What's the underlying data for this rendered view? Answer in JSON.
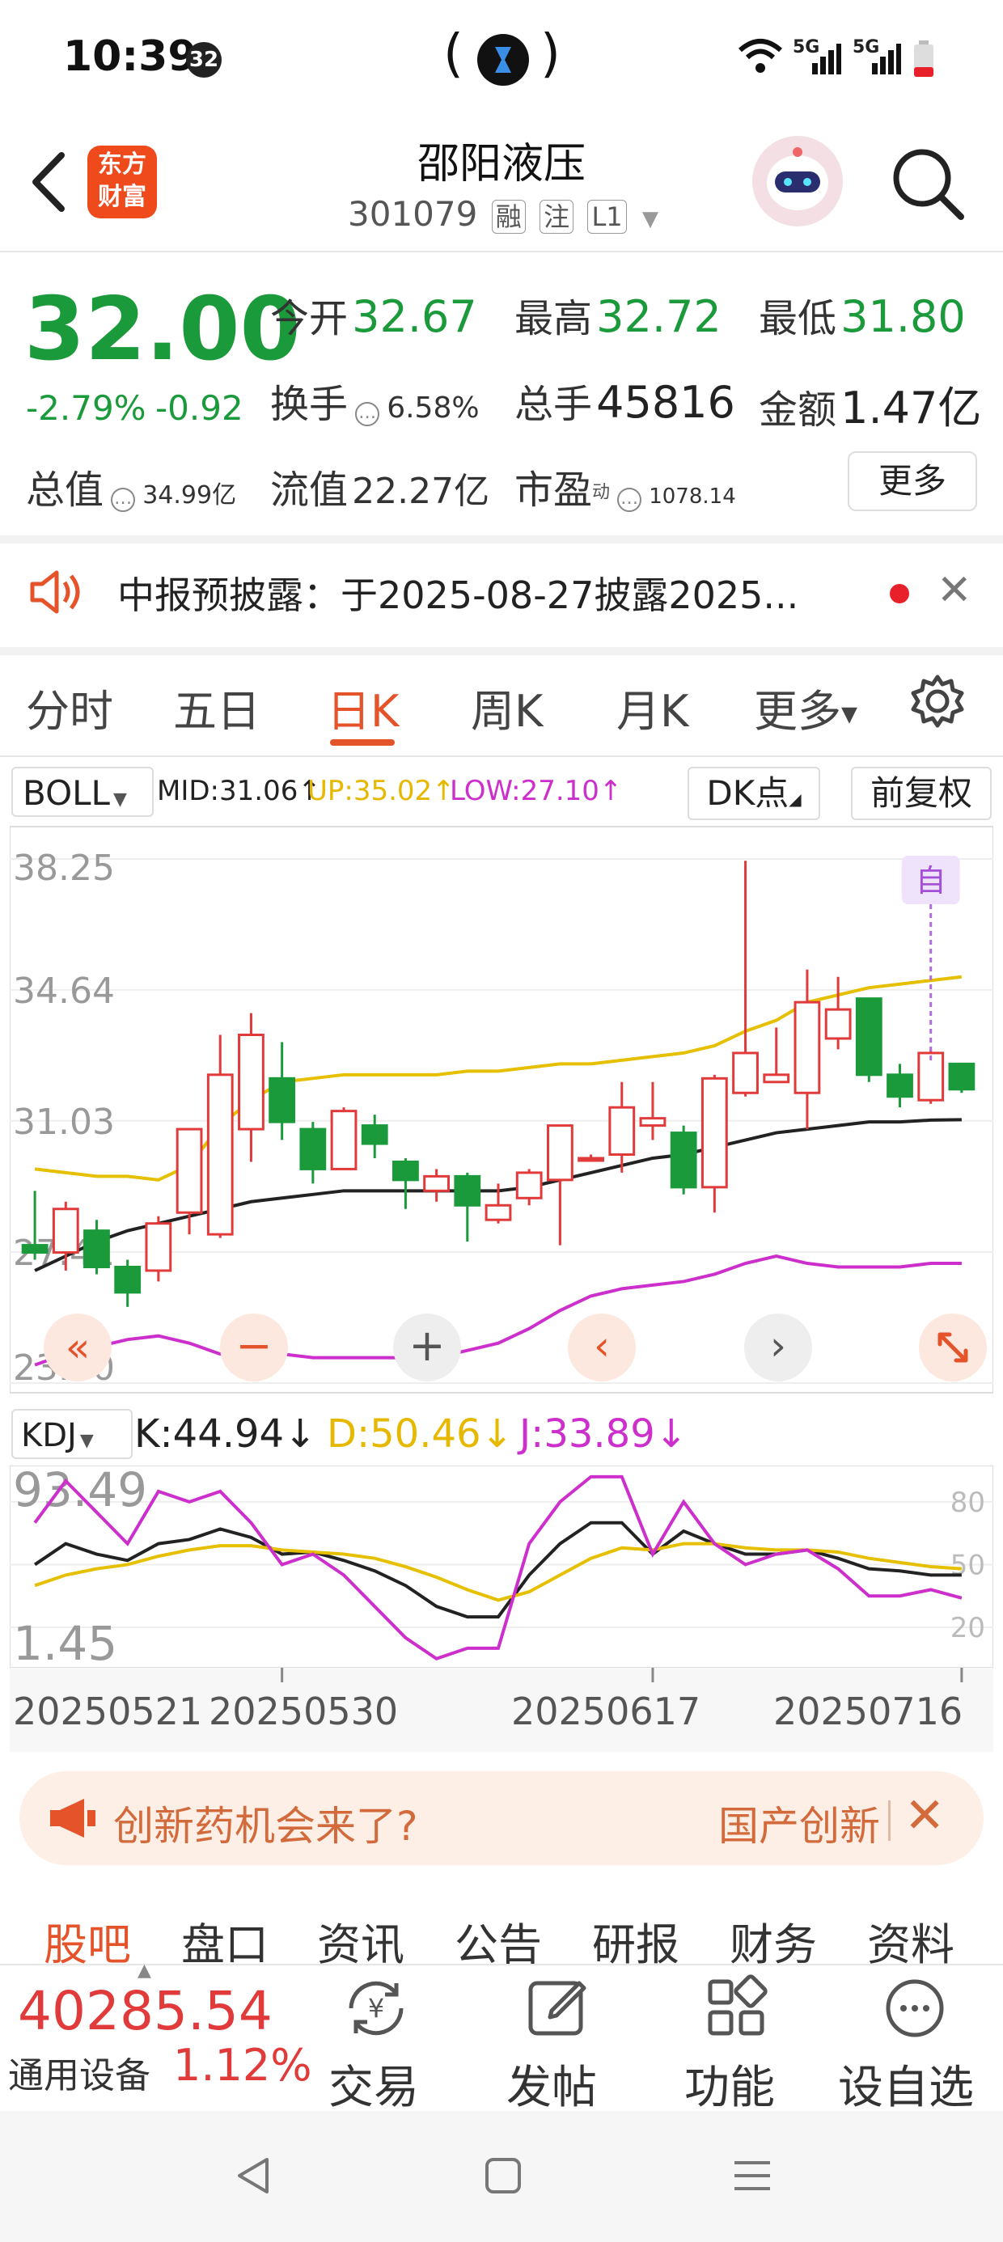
{
  "status_bar": {
    "time": "10:39",
    "badge": "32",
    "center_left": "(",
    "center_right": ")",
    "signal1": "5G",
    "signal2": "5G"
  },
  "header": {
    "logo_line1": "东方",
    "logo_line2": "财富",
    "title": "邵阳液压",
    "code": "301079",
    "tags": [
      "融",
      "注",
      "L1"
    ]
  },
  "quote": {
    "price": "32.00",
    "change_pct": "-2.79%",
    "change_amt": "-0.92",
    "open_label": "今开",
    "open": "32.67",
    "high_label": "最高",
    "high": "32.72",
    "low_label": "最低",
    "low": "31.80",
    "turnover_label": "换手",
    "turnover": "6.58%",
    "volume_label": "总手",
    "volume": "45816",
    "amount_label": "金额",
    "amount": "1.47亿",
    "mktcap_label": "总值",
    "mktcap": "34.99亿",
    "float_label": "流值",
    "float": "22.27亿",
    "pe_label": "市盈",
    "pe_sup": "动",
    "pe": "1078.14",
    "more": "更多"
  },
  "notice": {
    "text": "中报预披露：于2025-08-27披露2025..."
  },
  "tabs": [
    "分时",
    "五日",
    "日K",
    "周K",
    "月K",
    "更多"
  ],
  "chart_header": {
    "indicator": "BOLL",
    "mid": "MID:31.06↑",
    "up": "UP:35.02↑",
    "low": "LOW:27.10↑",
    "dk": "DK点",
    "adjust": "前复权",
    "kdj": "KDJ",
    "k": "K:44.94↓",
    "d": "D:50.46↓",
    "j": "J:33.89↓"
  },
  "colors": {
    "up": "#e13a3a",
    "down": "#1a9a3a",
    "mid_line": "#222222",
    "upper_band": "#e6c000",
    "lower_band": "#cc2fcc",
    "accent": "#e5532a"
  },
  "chart_data": [
    {
      "type": "candlestick",
      "y_ticks": [
        "38.25",
        "34.64",
        "31.03",
        "27.41",
        "23.80"
      ],
      "ylim": [
        23.8,
        38.25
      ],
      "x_ticks": [
        "20250521",
        "20250530",
        "20250617",
        "20250716"
      ],
      "marker": "自",
      "candles": [
        {
          "o": 27.6,
          "c": 27.4,
          "h": 29.1,
          "l": 27.2
        },
        {
          "o": 27.4,
          "c": 28.6,
          "h": 28.8,
          "l": 26.9
        },
        {
          "o": 28.0,
          "c": 27.0,
          "h": 28.3,
          "l": 26.8
        },
        {
          "o": 27.0,
          "c": 26.3,
          "h": 27.2,
          "l": 25.9
        },
        {
          "o": 26.9,
          "c": 28.2,
          "h": 28.4,
          "l": 26.6
        },
        {
          "o": 28.5,
          "c": 30.8,
          "h": 30.8,
          "l": 27.9
        },
        {
          "o": 27.9,
          "c": 32.3,
          "h": 33.4,
          "l": 27.8
        },
        {
          "o": 30.8,
          "c": 33.4,
          "h": 34.0,
          "l": 29.9
        },
        {
          "o": 32.2,
          "c": 31.0,
          "h": 33.2,
          "l": 30.5
        },
        {
          "o": 30.8,
          "c": 29.7,
          "h": 31.0,
          "l": 29.3
        },
        {
          "o": 29.7,
          "c": 31.3,
          "h": 31.4,
          "l": 29.7
        },
        {
          "o": 30.9,
          "c": 30.4,
          "h": 31.2,
          "l": 30.0
        },
        {
          "o": 29.9,
          "c": 29.4,
          "h": 30.0,
          "l": 28.6
        },
        {
          "o": 29.1,
          "c": 29.5,
          "h": 29.7,
          "l": 28.8
        },
        {
          "o": 29.5,
          "c": 28.7,
          "h": 29.6,
          "l": 27.7
        },
        {
          "o": 28.3,
          "c": 28.7,
          "h": 29.3,
          "l": 28.2
        },
        {
          "o": 28.9,
          "c": 29.6,
          "h": 29.7,
          "l": 28.7
        },
        {
          "o": 29.4,
          "c": 30.9,
          "h": 30.9,
          "l": 27.6
        },
        {
          "o": 30.0,
          "c": 30.0,
          "h": 30.1,
          "l": 29.9
        },
        {
          "o": 30.1,
          "c": 31.4,
          "h": 32.1,
          "l": 29.6
        },
        {
          "o": 30.9,
          "c": 31.1,
          "h": 32.1,
          "l": 30.5
        },
        {
          "o": 30.7,
          "c": 29.2,
          "h": 30.9,
          "l": 29.0
        },
        {
          "o": 29.2,
          "c": 32.2,
          "h": 32.3,
          "l": 28.5
        },
        {
          "o": 31.8,
          "c": 32.9,
          "h": 38.2,
          "l": 31.7
        },
        {
          "o": 32.1,
          "c": 32.3,
          "h": 33.6,
          "l": 32.1
        },
        {
          "o": 31.8,
          "c": 34.3,
          "h": 35.2,
          "l": 30.8
        },
        {
          "o": 33.3,
          "c": 34.1,
          "h": 35.0,
          "l": 33.0
        },
        {
          "o": 34.4,
          "c": 32.3,
          "h": 34.4,
          "l": 32.1
        },
        {
          "o": 32.3,
          "c": 31.7,
          "h": 32.6,
          "l": 31.4
        },
        {
          "o": 31.6,
          "c": 32.9,
          "h": 33.0,
          "l": 31.5
        },
        {
          "o": 32.6,
          "c": 31.9,
          "h": 32.6,
          "l": 31.8
        }
      ],
      "series": [
        {
          "name": "MID",
          "values": [
            26.9,
            27.3,
            27.7,
            28.0,
            28.2,
            28.4,
            28.6,
            28.8,
            28.9,
            29.0,
            29.1,
            29.1,
            29.1,
            29.1,
            29.1,
            29.1,
            29.2,
            29.4,
            29.6,
            29.8,
            30.0,
            30.1,
            30.3,
            30.5,
            30.7,
            30.8,
            30.9,
            31.0,
            31.0,
            31.05,
            31.06
          ]
        },
        {
          "name": "UP",
          "values": [
            29.7,
            29.6,
            29.5,
            29.5,
            29.4,
            29.8,
            30.9,
            31.6,
            32.1,
            32.2,
            32.3,
            32.3,
            32.3,
            32.3,
            32.4,
            32.4,
            32.5,
            32.6,
            32.6,
            32.7,
            32.8,
            32.9,
            33.1,
            33.5,
            33.8,
            34.3,
            34.5,
            34.7,
            34.8,
            34.9,
            35.0
          ]
        },
        {
          "name": "LOW",
          "values": [
            24.3,
            24.6,
            24.8,
            25.0,
            25.1,
            24.9,
            24.6,
            24.6,
            24.6,
            24.5,
            24.5,
            24.5,
            24.5,
            24.5,
            24.7,
            24.9,
            25.3,
            25.8,
            26.2,
            26.4,
            26.5,
            26.6,
            26.8,
            27.1,
            27.3,
            27.1,
            27.0,
            27.0,
            27.0,
            27.1,
            27.1
          ]
        }
      ]
    },
    {
      "type": "line",
      "name": "KDJ",
      "y_ticks": [
        "93.49",
        "1.45"
      ],
      "grid_labels": [
        "80",
        "50",
        "20"
      ],
      "ylim": [
        1.45,
        93.49
      ],
      "series": [
        {
          "name": "K",
          "values": [
            50,
            60,
            55,
            52,
            60,
            62,
            67,
            63,
            55,
            56,
            52,
            47,
            40,
            30,
            25,
            25,
            45,
            60,
            70,
            70,
            55,
            66,
            60,
            55,
            55,
            57,
            53,
            48,
            47,
            45,
            45
          ]
        },
        {
          "name": "D",
          "values": [
            40,
            45,
            48,
            50,
            54,
            57,
            59,
            59,
            57,
            56,
            55,
            53,
            49,
            44,
            38,
            33,
            37,
            45,
            53,
            58,
            57,
            60,
            60,
            58,
            57,
            57,
            56,
            53,
            51,
            49,
            48
          ]
        },
        {
          "name": "J",
          "values": [
            70,
            90,
            75,
            60,
            85,
            80,
            85,
            70,
            50,
            55,
            45,
            30,
            15,
            5,
            10,
            10,
            60,
            80,
            92,
            92,
            55,
            80,
            60,
            50,
            55,
            57,
            48,
            35,
            35,
            38,
            34
          ]
        }
      ]
    }
  ],
  "banner": {
    "text": "创新药机会来了?",
    "right": "国产创新"
  },
  "bottom_tabs": [
    "股吧",
    "盘口",
    "资讯",
    "公告",
    "研报",
    "财务",
    "资料"
  ],
  "bottom_bar": {
    "index_value": "40285.54",
    "index_name": "通用设备",
    "index_change": "1.12%",
    "trade": "交易",
    "post": "发帖",
    "function": "功能",
    "watchlist": "设自选"
  }
}
